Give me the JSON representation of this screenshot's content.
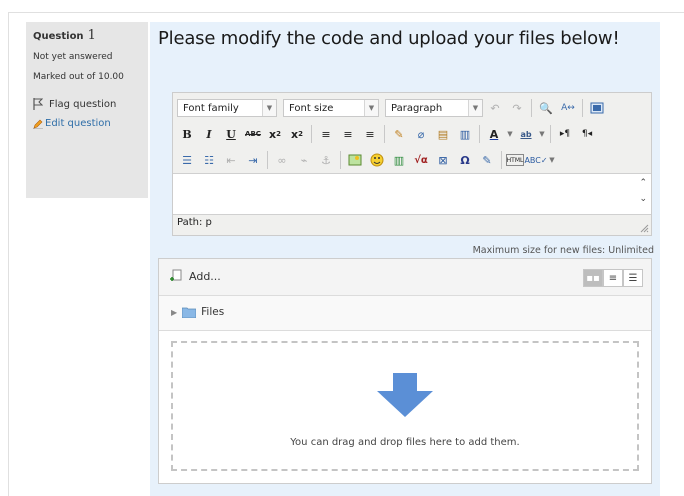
{
  "question": {
    "label": "Question",
    "number": "1",
    "state": "Not yet answered",
    "grade": "Marked out of 10.00",
    "flag_label": "Flag question",
    "edit_label": "Edit question",
    "text": "Please modify the code and upload your files below!"
  },
  "editor": {
    "font_family": "Font family",
    "font_size": "Font size",
    "format": "Paragraph",
    "path": "Path: p",
    "icons": [
      "undo-icon",
      "redo-icon",
      "find-icon",
      "replace-icon",
      "fullscreen-icon",
      "bold-icon",
      "italic-icon",
      "underline-icon",
      "strikethrough-icon",
      "subscript-icon",
      "superscript-icon",
      "align-left-icon",
      "align-center-icon",
      "align-right-icon",
      "clean-icon",
      "clear-icon",
      "paste-text-icon",
      "paste-word-icon",
      "text-color-icon",
      "highlight-icon",
      "ltr-icon",
      "rtl-icon",
      "bullet-list-icon",
      "numbered-list-icon",
      "outdent-icon",
      "indent-icon",
      "link-icon",
      "unlink-icon",
      "anchor-icon",
      "image-icon",
      "emoticon-icon",
      "media-icon",
      "equation-icon",
      "moodle-media-icon",
      "special-char-icon",
      "nonbreaking-icon",
      "html-icon",
      "spellcheck-icon"
    ]
  },
  "filepicker": {
    "max_size": "Maximum size for new files: Unlimited",
    "add_label": "Add...",
    "folder_label": "Files",
    "drop_text": "You can drag and drop files here to add them."
  },
  "colors": {
    "panel_bg": "#e6e6e6",
    "formulation_bg": "#e7f1fb",
    "link": "#2f6ea8",
    "drop_arrow": "#5b8fd6"
  }
}
